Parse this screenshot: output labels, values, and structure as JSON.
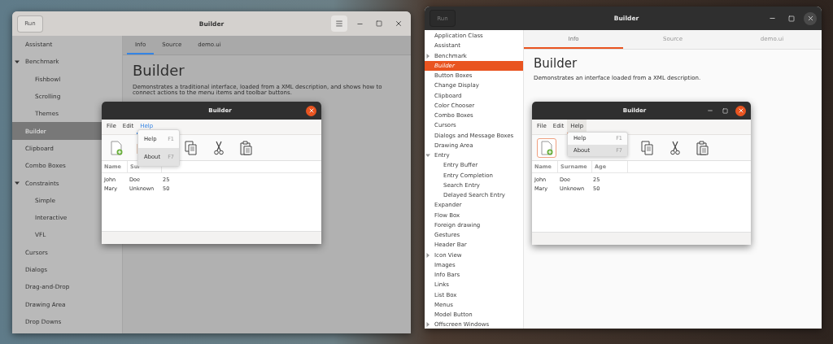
{
  "windows": [
    {
      "kind": "backdrop",
      "header": {
        "run_label": "Run",
        "title": "Builder"
      },
      "sidebar": {
        "items": [
          {
            "label": "Assistant",
            "selected": false
          },
          {
            "label": "Benchmark",
            "selected": false,
            "expanded": true,
            "children": [
              {
                "label": "Fishbowl",
                "selected": false
              },
              {
                "label": "Scrolling",
                "selected": false
              },
              {
                "label": "Themes",
                "selected": false
              }
            ]
          },
          {
            "label": "Builder",
            "selected": true
          },
          {
            "label": "Clipboard",
            "selected": false
          },
          {
            "label": "Combo Boxes",
            "selected": false
          },
          {
            "label": "Constraints",
            "selected": false,
            "expanded": true,
            "children": [
              {
                "label": "Simple",
                "selected": false
              },
              {
                "label": "Interactive",
                "selected": false
              },
              {
                "label": "VFL",
                "selected": false
              }
            ]
          },
          {
            "label": "Cursors",
            "selected": false
          },
          {
            "label": "Dialogs",
            "selected": false
          },
          {
            "label": "Drag-and-Drop",
            "selected": false
          },
          {
            "label": "Drawing Area",
            "selected": false
          },
          {
            "label": "Drop Downs",
            "selected": false
          }
        ]
      },
      "tabs": [
        {
          "label": "Info",
          "selected": true
        },
        {
          "label": "Source",
          "selected": false
        },
        {
          "label": "demo.ui",
          "selected": false
        }
      ],
      "content": {
        "heading": "Builder",
        "description": "Demonstrates a traditional interface, loaded from a XML description, and shows how to connect actions to the menu items and toolbar buttons."
      },
      "dialog": {
        "title": "Builder",
        "menus": [
          {
            "label": "File",
            "selected": false
          },
          {
            "label": "Edit",
            "selected": false
          },
          {
            "label": "Help",
            "selected": true
          }
        ],
        "popup": [
          {
            "label": "Help",
            "accel": "F1",
            "selected": false
          },
          {
            "label": "About",
            "accel": "F7",
            "selected": true
          }
        ],
        "table": {
          "columns": [
            "Name",
            "Sur"
          ],
          "rows": [
            [
              "John",
              "Doe",
              "25"
            ],
            [
              "Mary",
              "Unknown",
              "50"
            ]
          ]
        }
      }
    },
    {
      "kind": "active",
      "header": {
        "run_label": "Run",
        "title": "Builder"
      },
      "sidebar": {
        "items": [
          {
            "label": "Application Class",
            "selected": false
          },
          {
            "label": "Assistant",
            "selected": false
          },
          {
            "label": "Benchmark",
            "selected": false,
            "expanded": false
          },
          {
            "label": "Builder",
            "selected": true
          },
          {
            "label": "Button Boxes",
            "selected": false
          },
          {
            "label": "Change Display",
            "selected": false
          },
          {
            "label": "Clipboard",
            "selected": false
          },
          {
            "label": "Color Chooser",
            "selected": false
          },
          {
            "label": "Combo Boxes",
            "selected": false
          },
          {
            "label": "Cursors",
            "selected": false
          },
          {
            "label": "Dialogs and Message Boxes",
            "selected": false
          },
          {
            "label": "Drawing Area",
            "selected": false
          },
          {
            "label": "Entry",
            "selected": false,
            "expanded": true,
            "children": [
              {
                "label": "Entry Buffer",
                "selected": false
              },
              {
                "label": "Entry Completion",
                "selected": false
              },
              {
                "label": "Search Entry",
                "selected": false
              },
              {
                "label": "Delayed Search Entry",
                "selected": false
              }
            ]
          },
          {
            "label": "Expander",
            "selected": false
          },
          {
            "label": "Flow Box",
            "selected": false
          },
          {
            "label": "Foreign drawing",
            "selected": false
          },
          {
            "label": "Gestures",
            "selected": false
          },
          {
            "label": "Header Bar",
            "selected": false
          },
          {
            "label": "Icon View",
            "selected": false,
            "expanded": false
          },
          {
            "label": "Images",
            "selected": false
          },
          {
            "label": "Info Bars",
            "selected": false
          },
          {
            "label": "Links",
            "selected": false
          },
          {
            "label": "List Box",
            "selected": false
          },
          {
            "label": "Menus",
            "selected": false
          },
          {
            "label": "Model Button",
            "selected": false
          },
          {
            "label": "Offscreen Windows",
            "selected": false,
            "expanded": false
          }
        ]
      },
      "tabs": [
        {
          "label": "Info",
          "selected": true
        },
        {
          "label": "Source",
          "selected": false
        },
        {
          "label": "demo.ui",
          "selected": false
        }
      ],
      "content": {
        "heading": "Builder",
        "description": "Demonstrates an interface loaded from a XML description."
      },
      "dialog": {
        "title": "Builder",
        "menus": [
          {
            "label": "File",
            "selected": false
          },
          {
            "label": "Edit",
            "selected": false
          },
          {
            "label": "Help",
            "selected": true
          }
        ],
        "popup": [
          {
            "label": "Help",
            "accel": "F1",
            "selected": false
          },
          {
            "label": "About",
            "accel": "F7",
            "selected": true
          }
        ],
        "table": {
          "columns": [
            "Name",
            "Surname",
            "Age"
          ],
          "rows": [
            [
              "John",
              "Doe",
              "25"
            ],
            [
              "Mary",
              "Unknown",
              "50"
            ]
          ]
        }
      }
    }
  ]
}
